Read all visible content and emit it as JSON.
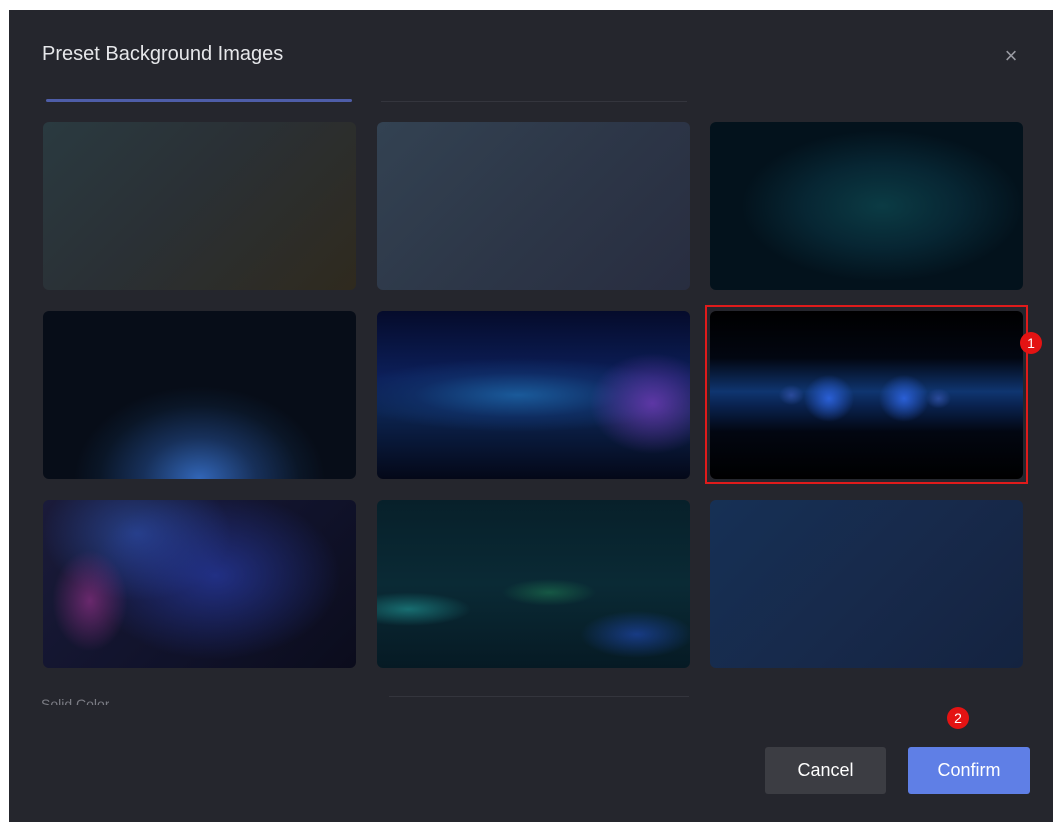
{
  "dialog": {
    "title": "Preset Background Images",
    "close_icon": "close-icon",
    "close_glyph": "×"
  },
  "thumbnails": [
    {
      "name": "background-1",
      "selected": false
    },
    {
      "name": "background-2",
      "selected": false
    },
    {
      "name": "background-3",
      "selected": false
    },
    {
      "name": "background-4",
      "selected": false
    },
    {
      "name": "background-5",
      "selected": false
    },
    {
      "name": "background-6",
      "selected": true
    },
    {
      "name": "background-7",
      "selected": false
    },
    {
      "name": "background-8",
      "selected": false
    },
    {
      "name": "background-9",
      "selected": false
    }
  ],
  "annotations": {
    "badge1": "1",
    "badge2": "2",
    "color": "#e41313"
  },
  "next_section": {
    "label": "Solid Color"
  },
  "footer": {
    "cancel_label": "Cancel",
    "confirm_label": "Confirm"
  },
  "colors": {
    "dialog_bg": "#25262d",
    "accent": "#5f7fe6",
    "selection_outline": "#e01b1b"
  }
}
